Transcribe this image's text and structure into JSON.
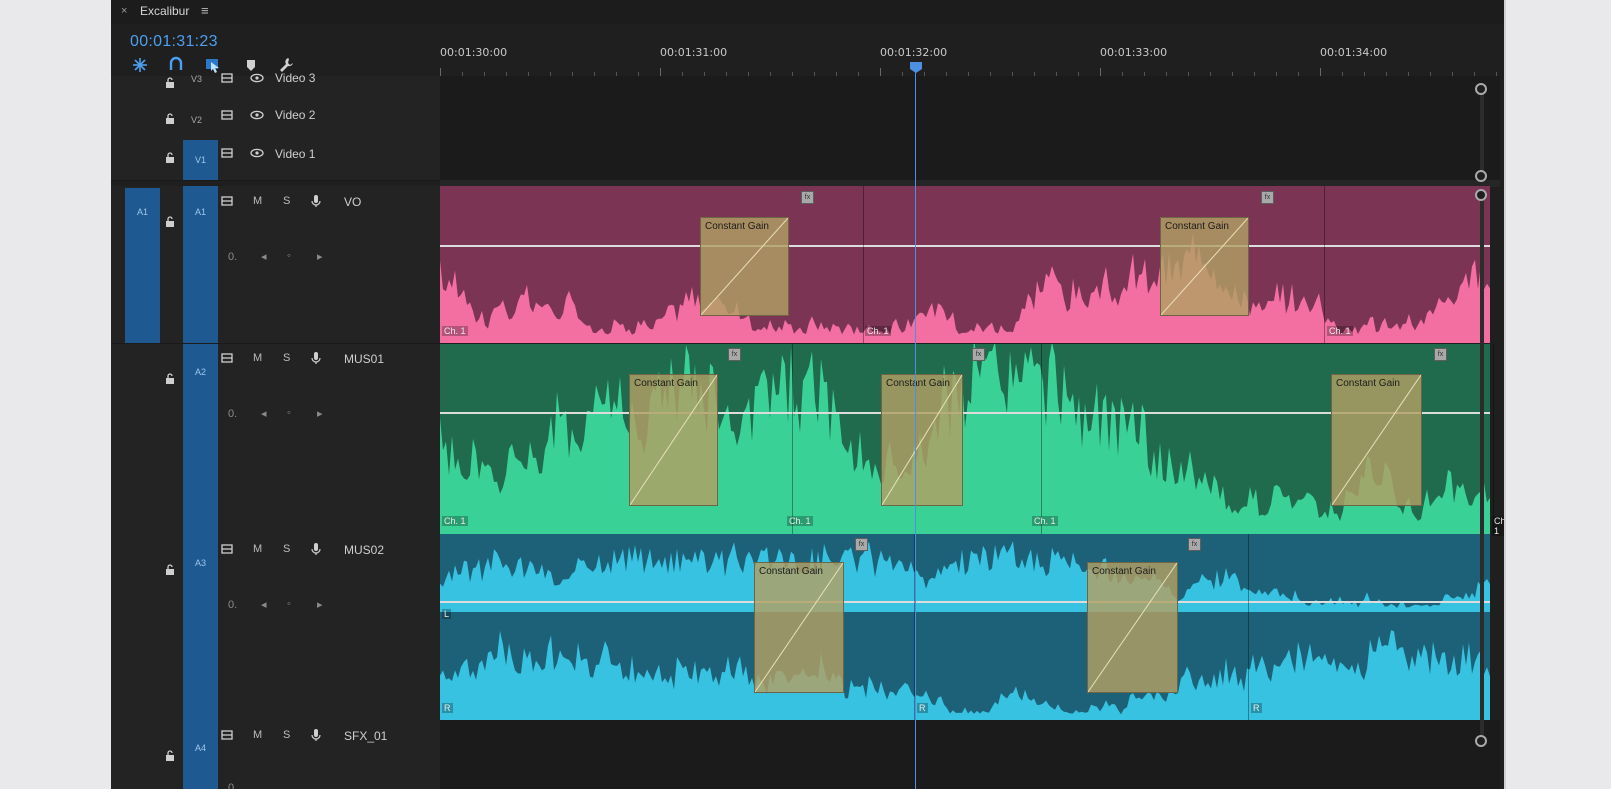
{
  "app": {
    "sequence_name": "Excalibur",
    "close_glyph": "×",
    "menu_glyph": "≡",
    "timecode": "00:01:31:23"
  },
  "ruler": {
    "labels": [
      "00:01:30:00",
      "00:01:31:00",
      "00:01:32:00",
      "00:01:33:00",
      "00:01:34:00"
    ]
  },
  "tracks": {
    "v3": {
      "id": "V3",
      "name": "Video 3"
    },
    "v2": {
      "id": "V2",
      "name": "Video 2"
    },
    "v1": {
      "id": "V1",
      "name": "Video 1"
    },
    "a1": {
      "source": "A1",
      "id": "A1",
      "name": "VO",
      "m": "M",
      "s": "S",
      "vol": "0."
    },
    "a2": {
      "id": "A2",
      "name": "MUS01",
      "m": "M",
      "s": "S",
      "vol": "0."
    },
    "a3": {
      "id": "A3",
      "name": "MUS02",
      "m": "M",
      "s": "S",
      "vol": "0."
    },
    "a4": {
      "id": "A4",
      "name": "SFX_01",
      "m": "M",
      "s": "S",
      "vol": "0."
    }
  },
  "clips": {
    "vo": {
      "ch": "Ch. 1",
      "color": "#f36fa2",
      "bg": "#7b3454"
    },
    "mus01": {
      "ch": "Ch. 1",
      "color": "#3ad196",
      "bg": "#206b4d"
    },
    "mus02": {
      "ch_l": "L",
      "ch_r": "R",
      "color": "#36c2e0",
      "bg": "#1c6178"
    },
    "crossfade_label": "Constant Gain",
    "fx_glyph": "fx"
  }
}
